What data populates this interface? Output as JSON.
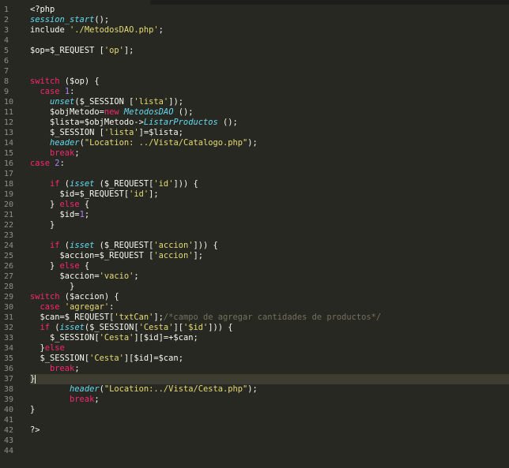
{
  "editor": {
    "line_numbers": [
      "1",
      "2",
      "3",
      "4",
      "5",
      "6",
      "7",
      "8",
      "9",
      "10",
      "11",
      "12",
      "13",
      "14",
      "15",
      "16",
      "17",
      "18",
      "19",
      "20",
      "21",
      "22",
      "23",
      "24",
      "25",
      "26",
      "27",
      "28",
      "29",
      "30",
      "31",
      "32",
      "33",
      "34",
      "35",
      "36",
      "37",
      "38",
      "39",
      "40",
      "41",
      "42",
      "43",
      "44"
    ],
    "lines": [
      [
        [
          "plain",
          "<?php"
        ]
      ],
      [
        [
          "fn",
          "session_start"
        ],
        [
          "plain",
          "();"
        ]
      ],
      [
        [
          "plain",
          "include "
        ],
        [
          "str",
          "'./MetodosDAO.php'"
        ],
        [
          "plain",
          ";"
        ]
      ],
      [],
      [
        [
          "plain",
          "$op=$_REQUEST ["
        ],
        [
          "str",
          "'op'"
        ],
        [
          "plain",
          "];"
        ]
      ],
      [],
      [],
      [
        [
          "kw",
          "switch"
        ],
        [
          "plain",
          " ($op) {"
        ]
      ],
      [
        [
          "plain",
          "  "
        ],
        [
          "kw",
          "case"
        ],
        [
          "plain",
          " "
        ],
        [
          "num",
          "1"
        ],
        [
          "plain",
          ":"
        ]
      ],
      [
        [
          "plain",
          "    "
        ],
        [
          "fn",
          "unset"
        ],
        [
          "plain",
          "($_SESSION ["
        ],
        [
          "str",
          "'lista'"
        ],
        [
          "plain",
          "]);"
        ]
      ],
      [
        [
          "plain",
          "    $objMetodo="
        ],
        [
          "kw",
          "new"
        ],
        [
          "plain",
          " "
        ],
        [
          "cls",
          "MetodosDAO"
        ],
        [
          "plain",
          " ();"
        ]
      ],
      [
        [
          "plain",
          "    $lista=$objMetodo->"
        ],
        [
          "fn",
          "ListarProductos"
        ],
        [
          "plain",
          " ();"
        ]
      ],
      [
        [
          "plain",
          "    $_SESSION ["
        ],
        [
          "str",
          "'lista'"
        ],
        [
          "plain",
          "]=$lista;"
        ]
      ],
      [
        [
          "plain",
          "    "
        ],
        [
          "fn",
          "header"
        ],
        [
          "plain",
          "("
        ],
        [
          "str",
          "\"Location: ../Vista/Catalogo.php\""
        ],
        [
          "plain",
          ");"
        ]
      ],
      [
        [
          "plain",
          "    "
        ],
        [
          "kw",
          "break"
        ],
        [
          "plain",
          ";"
        ]
      ],
      [
        [
          "kw",
          "case"
        ],
        [
          "plain",
          " "
        ],
        [
          "num",
          "2"
        ],
        [
          "plain",
          ":"
        ]
      ],
      [],
      [
        [
          "plain",
          "    "
        ],
        [
          "kw",
          "if"
        ],
        [
          "plain",
          " ("
        ],
        [
          "fn",
          "isset"
        ],
        [
          "plain",
          " ($_REQUEST["
        ],
        [
          "str",
          "'id'"
        ],
        [
          "plain",
          "])) {"
        ]
      ],
      [
        [
          "plain",
          "      $id=$_REQUEST["
        ],
        [
          "str",
          "'id'"
        ],
        [
          "plain",
          "];"
        ]
      ],
      [
        [
          "plain",
          "    } "
        ],
        [
          "kw",
          "else"
        ],
        [
          "plain",
          " {"
        ]
      ],
      [
        [
          "plain",
          "      $id="
        ],
        [
          "num",
          "1"
        ],
        [
          "plain",
          ";"
        ]
      ],
      [
        [
          "plain",
          "    }"
        ]
      ],
      [],
      [
        [
          "plain",
          "    "
        ],
        [
          "kw",
          "if"
        ],
        [
          "plain",
          " ("
        ],
        [
          "fn",
          "isset"
        ],
        [
          "plain",
          " ($_REQUEST["
        ],
        [
          "str",
          "'accion'"
        ],
        [
          "plain",
          "])) {"
        ]
      ],
      [
        [
          "plain",
          "      $accion=$_REQUEST ["
        ],
        [
          "str",
          "'accion'"
        ],
        [
          "plain",
          "];"
        ]
      ],
      [
        [
          "plain",
          "    } "
        ],
        [
          "kw",
          "else"
        ],
        [
          "plain",
          " {"
        ]
      ],
      [
        [
          "plain",
          "      $accion="
        ],
        [
          "str",
          "'vacio'"
        ],
        [
          "plain",
          ";"
        ]
      ],
      [
        [
          "plain",
          "        }"
        ]
      ],
      [
        [
          "kw",
          "switch"
        ],
        [
          "plain",
          " ($accion) {"
        ]
      ],
      [
        [
          "plain",
          "  "
        ],
        [
          "kw",
          "case"
        ],
        [
          "plain",
          " "
        ],
        [
          "str",
          "'agregar'"
        ],
        [
          "plain",
          ":"
        ]
      ],
      [
        [
          "plain",
          "  $can=$_REQUEST["
        ],
        [
          "str",
          "'txtCan'"
        ],
        [
          "plain",
          "];"
        ],
        [
          "cmt",
          "/*campo de agregar cantidades de productos*/"
        ]
      ],
      [
        [
          "plain",
          "  "
        ],
        [
          "kw",
          "if"
        ],
        [
          "plain",
          " ("
        ],
        [
          "fn",
          "isset"
        ],
        [
          "plain",
          "($_SESSION["
        ],
        [
          "str",
          "'Cesta'"
        ],
        [
          "plain",
          "]["
        ],
        [
          "str",
          "'$id'"
        ],
        [
          "plain",
          "])) {"
        ]
      ],
      [
        [
          "plain",
          "    $_SESSION["
        ],
        [
          "str",
          "'Cesta'"
        ],
        [
          "plain",
          "][$id]=+$can;"
        ]
      ],
      [
        [
          "plain",
          "  }"
        ],
        [
          "kw",
          "else"
        ]
      ],
      [
        [
          "plain",
          "  $_SESSION["
        ],
        [
          "str",
          "'Cesta'"
        ],
        [
          "plain",
          "][$id]=$can;"
        ]
      ],
      [
        [
          "plain",
          "    "
        ],
        [
          "kw",
          "break"
        ],
        [
          "plain",
          ";"
        ]
      ],
      [
        [
          "plain",
          "}"
        ]
      ],
      [
        [
          "plain",
          "        "
        ],
        [
          "fn",
          "header"
        ],
        [
          "plain",
          "("
        ],
        [
          "str",
          "\"Location:../Vista/Cesta.php\""
        ],
        [
          "plain",
          ");"
        ]
      ],
      [
        [
          "plain",
          "        "
        ],
        [
          "kw",
          "break"
        ],
        [
          "plain",
          ";"
        ]
      ],
      [
        [
          "plain",
          "}"
        ]
      ],
      [],
      [
        [
          "plain",
          "?>"
        ]
      ],
      [],
      []
    ],
    "cursor_line": 37,
    "colors": {
      "background": "#272822",
      "keyword": "#f92672",
      "function": "#66d9ef",
      "string": "#e6db74",
      "number": "#ae81ff",
      "comment": "#75715e",
      "text": "#f8f8f2",
      "line_number": "#8f908a"
    }
  }
}
